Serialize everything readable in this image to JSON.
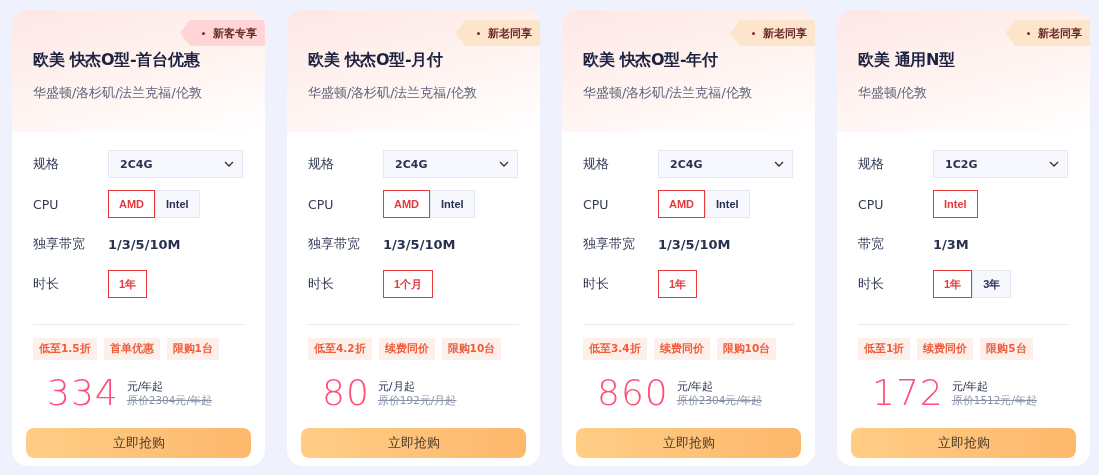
{
  "plans": [
    {
      "badge": {
        "label": "新客专享",
        "color": "#ffd5d5"
      },
      "title": "欧美 快杰O型-首台优惠",
      "regions": "华盛顿/洛杉矶/法兰克福/伦敦",
      "specs": [
        {
          "kind": "select",
          "label": "规格",
          "value": "2C4G"
        },
        {
          "kind": "options",
          "label": "CPU",
          "options": [
            {
              "label": "AMD",
              "selected": true
            },
            {
              "label": "Intel",
              "selected": false
            }
          ]
        },
        {
          "kind": "text",
          "label": "独享带宽",
          "value": "1/3/5/10M"
        },
        {
          "kind": "options",
          "label": "时长",
          "options": [
            {
              "label": "1年",
              "selected": true
            }
          ]
        }
      ],
      "tags": [
        "低至1.5折",
        "首单优惠",
        "限购1台"
      ],
      "price": "334",
      "unit": "元/年起",
      "original": "原价2304元/年起",
      "button": "立即抢购"
    },
    {
      "badge": {
        "label": "新老同享",
        "color": "#fde5cc"
      },
      "title": "欧美 快杰O型-月付",
      "regions": "华盛顿/洛杉矶/法兰克福/伦敦",
      "specs": [
        {
          "kind": "select",
          "label": "规格",
          "value": "2C4G"
        },
        {
          "kind": "options",
          "label": "CPU",
          "options": [
            {
              "label": "AMD",
              "selected": true
            },
            {
              "label": "Intel",
              "selected": false
            }
          ]
        },
        {
          "kind": "text",
          "label": "独享带宽",
          "value": "1/3/5/10M"
        },
        {
          "kind": "options",
          "label": "时长",
          "options": [
            {
              "label": "1个月",
              "selected": true
            }
          ]
        }
      ],
      "tags": [
        "低至4.2折",
        "续费同价",
        "限购10台"
      ],
      "price": "80",
      "unit": "元/月起",
      "original": "原价192元/月起",
      "button": "立即抢购"
    },
    {
      "badge": {
        "label": "新老同享",
        "color": "#fde5cc"
      },
      "title": "欧美 快杰O型-年付",
      "regions": "华盛顿/洛杉矶/法兰克福/伦敦",
      "specs": [
        {
          "kind": "select",
          "label": "规格",
          "value": "2C4G"
        },
        {
          "kind": "options",
          "label": "CPU",
          "options": [
            {
              "label": "AMD",
              "selected": true
            },
            {
              "label": "Intel",
              "selected": false
            }
          ]
        },
        {
          "kind": "text",
          "label": "独享带宽",
          "value": "1/3/5/10M"
        },
        {
          "kind": "options",
          "label": "时长",
          "options": [
            {
              "label": "1年",
              "selected": true
            }
          ]
        }
      ],
      "tags": [
        "低至3.4折",
        "续费同价",
        "限购10台"
      ],
      "price": "860",
      "unit": "元/年起",
      "original": "原价2304元/年起",
      "button": "立即抢购"
    },
    {
      "badge": {
        "label": "新老同享",
        "color": "#fde5cc"
      },
      "title": "欧美 通用N型",
      "regions": "华盛顿/伦敦",
      "specs": [
        {
          "kind": "select",
          "label": "规格",
          "value": "1C2G"
        },
        {
          "kind": "options",
          "label": "CPU",
          "options": [
            {
              "label": "Intel",
              "selected": true
            }
          ]
        },
        {
          "kind": "text",
          "label": "带宽",
          "value": "1/3M"
        },
        {
          "kind": "options",
          "label": "时长",
          "options": [
            {
              "label": "1年",
              "selected": true
            },
            {
              "label": "3年",
              "selected": false
            }
          ]
        }
      ],
      "tags": [
        "低至1折",
        "续费同价",
        "限购5台"
      ],
      "price": "172",
      "unit": "元/年起",
      "original": "原价1512元/年起",
      "button": "立即抢购"
    }
  ]
}
